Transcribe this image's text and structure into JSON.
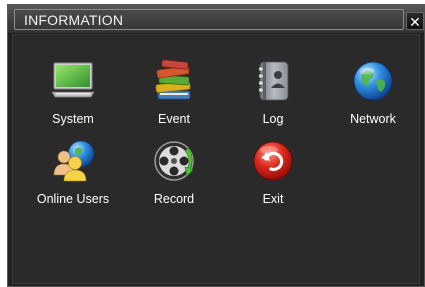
{
  "window": {
    "title": "INFORMATION",
    "close_label": "✕"
  },
  "menu": {
    "items": [
      {
        "label": "System",
        "icon": "monitor-icon"
      },
      {
        "label": "Event",
        "icon": "books-stack-icon"
      },
      {
        "label": "Log",
        "icon": "notebook-icon"
      },
      {
        "label": "Network",
        "icon": "globe-icon"
      },
      {
        "label": "Online Users",
        "icon": "users-globe-icon"
      },
      {
        "label": "Record",
        "icon": "film-reel-icon"
      },
      {
        "label": "Exit",
        "icon": "exit-arrow-icon"
      }
    ]
  }
}
